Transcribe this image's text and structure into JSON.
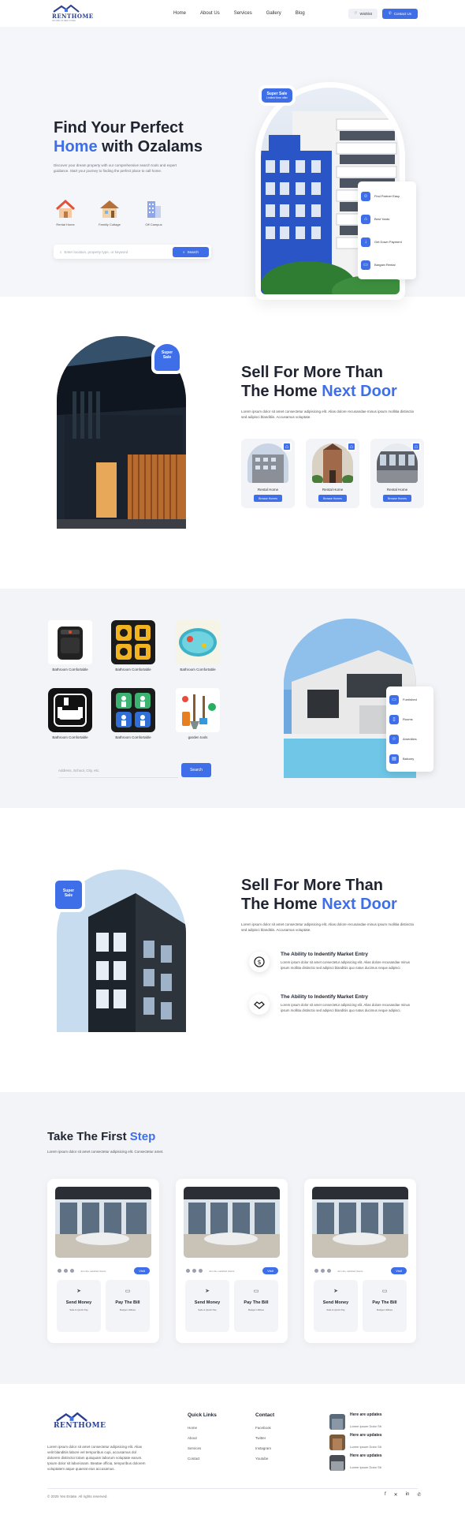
{
  "header": {
    "logo_text": "RENTHOME",
    "logo_sub": "NATURE OF RENT HOME",
    "nav": [
      "Home",
      "About Us",
      "Services",
      "Gallery",
      "Blog"
    ],
    "btn_outline": "Wishlist",
    "btn_primary": "Contact Us"
  },
  "hero": {
    "title_line1": "Find Your Perfect",
    "title_highlight": "Home",
    "title_rest": " with Ozalams",
    "description": "Discover your dream property with our comprehensive search tools and expert guidance. Start your journey to finding the perfect place to call home.",
    "categories": [
      {
        "label": "Rental Home",
        "icon": "house-icon"
      },
      {
        "label": "Familiy Cottage",
        "icon": "cottage-icon"
      },
      {
        "label": "Off Campus",
        "icon": "building-icon"
      }
    ],
    "search_placeholder": "Enter location, property type, or keyword",
    "search_button": "Search",
    "tag_title": "Super Sale",
    "tag_sub": "Limited time offer",
    "side_list": [
      "Find Partner Easy",
      "Best Yards",
      "Get Down Payment",
      "Bargain Rental"
    ]
  },
  "sell1": {
    "tag": "Super Sale",
    "title_line1": "Sell For More Than",
    "title_line2": "The Home ",
    "title_highlight": "Next Door",
    "desc": "Lorem ipsum dolor sit amet consectetur adipisicing elit. Alias dolore recusandae minus ipsum mollitia distinctio sed adipisci blanditiis. Accusamus voluptate.",
    "cards": [
      {
        "label": "Rental Home",
        "button": "Browse Homes"
      },
      {
        "label": "Rental Home",
        "button": "Browse Homes"
      },
      {
        "label": "Rental Home",
        "button": "Browse Homes"
      }
    ]
  },
  "grid": {
    "items": [
      {
        "label": "Bathroom Comfortable"
      },
      {
        "label": "Bathroom Comfortable"
      },
      {
        "label": "Bathroom Comfortable"
      },
      {
        "label": "Bathroom Comfortable"
      },
      {
        "label": "Bathroom Comfortable"
      },
      {
        "label": "garden tools"
      }
    ],
    "address_placeholder": "Address, School, City, etc.",
    "send_button": "Search",
    "side_list": [
      "Furnished",
      "Rooms",
      "Amenities",
      "Balcony"
    ]
  },
  "sell2": {
    "tag": "Super Sale",
    "title_line1": "Sell For More Than",
    "title_line2": "The Home ",
    "title_highlight": "Next Door",
    "desc": "Lorem ipsum dolor sit amet consectetur adipisicing elit. Alias dolore recusandae minus ipsum mollitia distinctio sed adipisci blanditiis. Accusamus voluptate.",
    "features": [
      {
        "title": "The Ability to Indentify Market Entry",
        "text": "Lorem ipsum dolor sit amet consectetur adipisicing elit. Alias dolore recusandae minus ipsum mollitia distinctio sed adipisci blanditiis quo natus ducimus neque adipisci."
      },
      {
        "title": "The Ability to Indentify Market Entry",
        "text": "Lorem ipsum dolor sit amet consectetur adipisicing elit. Alias dolore recusandae minus ipsum mollitia distinctio sed adipisci blanditiis quo natus ducimus neque adipisci."
      }
    ]
  },
  "steps": {
    "title": "Take The First ",
    "title_highlight": "Step",
    "subtitle": "Lorem ipsum dolor sit amet consectetur adipisicing elit. Consectetur amet.",
    "cards": [
      {
        "mini": "Join 2k+ satisfied clients",
        "visit": "Visit",
        "box1_title": "Send Money",
        "box1_sub": "Safe & Quick Pay",
        "box2_title": "Pay The Bill",
        "box2_sub": "Budget Utilities"
      },
      {
        "mini": "Join 2k+ satisfied clients",
        "visit": "Visit",
        "box1_title": "Send Money",
        "box1_sub": "Safe & Quick Pay",
        "box2_title": "Pay The Bill",
        "box2_sub": "Budget Utilities"
      },
      {
        "mini": "Join 2k+ satisfied clients",
        "visit": "Visit",
        "box1_title": "Send Money",
        "box1_sub": "Safe & Quick Pay",
        "box2_title": "Pay The Bill",
        "box2_sub": "Budget Utilities"
      }
    ]
  },
  "footer": {
    "logo_text": "RENTHOME",
    "about": "Lorem ipsum dolor sit amet consectetur adipisicing elit. Alias velit blanditiis labore vel temporibus cupi, accusamus dol dolorem distinctio totam quisquam laborum voluptate earum. Ipsum dolor sit laboriosam. Beatae officia, temporibus dolorem voluptatem atque quaerat eius accusamus.",
    "quick_links_title": "Quick Links",
    "quick_links": [
      "Home",
      "About",
      "Services",
      "Contact"
    ],
    "contact_title": "Contact",
    "contact_links": [
      "Facebook",
      "Twitter",
      "Instagram",
      "Youtube"
    ],
    "updates": [
      {
        "title": "Here are updates",
        "sub": "Lorem Ipsum Dolor Sit"
      },
      {
        "title": "Here are updates",
        "sub": "Lorem Ipsum Dolor Sit"
      },
      {
        "title": "Here are updates",
        "sub": "Lorem Ipsum Dolor Sit"
      }
    ],
    "copyright": "© 2025 Yes Estate. All rights reserved.",
    "social_icons": [
      "facebook-icon",
      "twitter-icon",
      "linkedin-icon",
      "whatsapp-icon"
    ]
  },
  "colors": {
    "accent": "#3f6fe8",
    "dark": "#1f2430",
    "panel": "#f3f4f8"
  }
}
